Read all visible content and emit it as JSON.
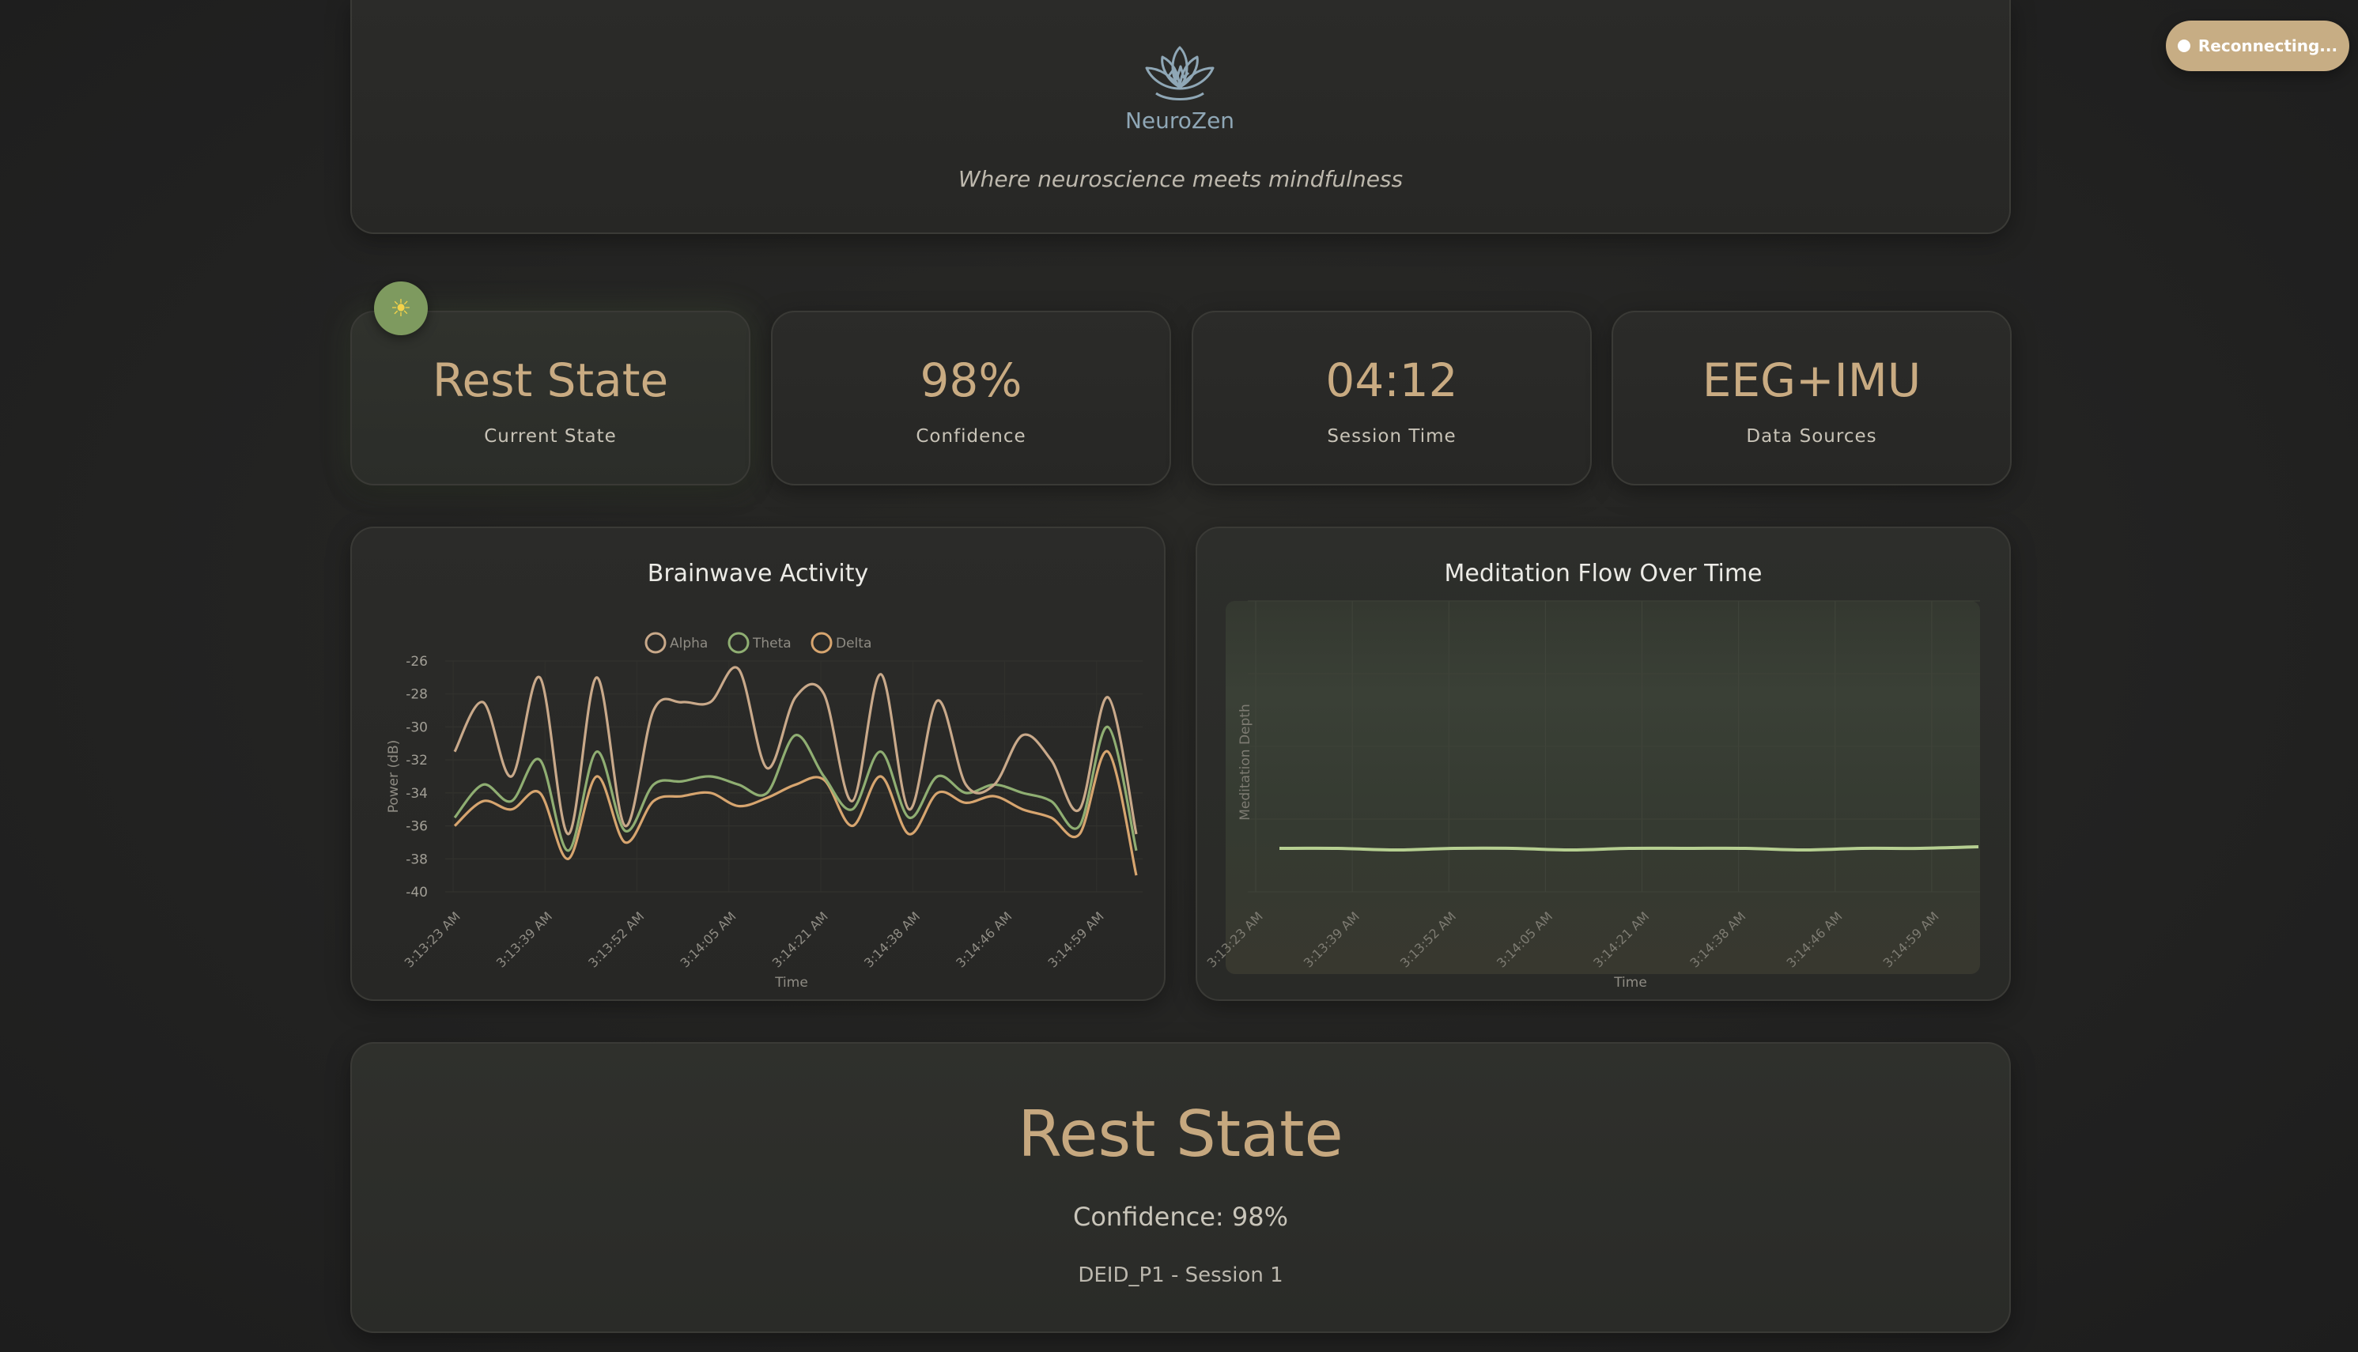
{
  "header": {
    "brand": "NeuroZen",
    "tagline": "Where neuroscience meets mindfulness",
    "logo_icon": "lotus-brain-icon"
  },
  "connection": {
    "status_label": "Reconnecting..."
  },
  "stats": {
    "state_badge_icon": "sun-icon",
    "current_state": {
      "value": "Rest State",
      "label": "Current State"
    },
    "confidence": {
      "value": "98%",
      "label": "Confidence"
    },
    "session_time": {
      "value": "04:12",
      "label": "Session Time"
    },
    "data_sources": {
      "value": "EEG+IMU",
      "label": "Data Sources"
    }
  },
  "colors": {
    "accent": "#c9ab82",
    "alpha": "#c9a98a",
    "theta": "#8fae72",
    "delta": "#d7a56f",
    "flow_line": "#b6cf91",
    "state_badge": "#7e9a5f"
  },
  "chart_data": [
    {
      "type": "line",
      "title": "Brainwave Activity",
      "xlabel": "Time",
      "ylabel": "Power (dB)",
      "ylim": [
        -40,
        -26
      ],
      "yticks": [
        -26,
        -28,
        -30,
        -32,
        -34,
        -36,
        -38,
        -40
      ],
      "xtick_labels": [
        "3:13:23 AM",
        "3:13:39 AM",
        "3:13:52 AM",
        "3:14:05 AM",
        "3:14:21 AM",
        "3:14:38 AM",
        "3:14:46 AM",
        "3:14:59 AM"
      ],
      "legend": [
        "Alpha",
        "Theta",
        "Delta"
      ],
      "legend_position": "top-center",
      "grid": true,
      "series": [
        {
          "name": "Alpha",
          "values": [
            -31.5,
            -28.5,
            -33,
            -27,
            -36.5,
            -27,
            -36,
            -29,
            -28.5,
            -28.5,
            -26.5,
            -32.5,
            -28.2,
            -28,
            -34.5,
            -26.8,
            -35,
            -28.4,
            -33.5,
            -33.5,
            -30.5,
            -32,
            -35,
            -28.2,
            -36.5
          ]
        },
        {
          "name": "Theta",
          "values": [
            -35.5,
            -33.5,
            -34.5,
            -32,
            -37.5,
            -31.5,
            -36.3,
            -33.5,
            -33.3,
            -33,
            -33.5,
            -34,
            -30.5,
            -33,
            -35,
            -31.5,
            -35.5,
            -33,
            -34,
            -33.5,
            -34,
            -34.5,
            -36,
            -30,
            -37.5
          ]
        },
        {
          "name": "Delta",
          "values": [
            -36,
            -34.5,
            -35,
            -34,
            -38,
            -33,
            -37,
            -34.5,
            -34.2,
            -34,
            -34.8,
            -34.3,
            -33.5,
            -33.2,
            -36,
            -33,
            -36.5,
            -34,
            -34.6,
            -34.2,
            -35,
            -35.5,
            -36.5,
            -31.5,
            -39
          ]
        }
      ]
    },
    {
      "type": "line",
      "title": "Meditation Flow Over Time",
      "xlabel": "Time",
      "ylabel": "Meditation Depth",
      "xtick_labels": [
        "3:13:23 AM",
        "3:13:39 AM",
        "3:13:52 AM",
        "3:14:05 AM",
        "3:14:21 AM",
        "3:14:38 AM",
        "3:14:46 AM",
        "3:14:59 AM"
      ],
      "grid": true,
      "series": [
        {
          "values": [
            0.2,
            0.2,
            0.19,
            0.2,
            0.2,
            0.19,
            0.2,
            0.2,
            0.2,
            0.19,
            0.2,
            0.2,
            0.21
          ]
        }
      ]
    }
  ],
  "current_state_panel": {
    "state": "Rest State",
    "confidence_text": "Confidence: 98%",
    "session_text": "DEID_P1 - Session 1"
  }
}
